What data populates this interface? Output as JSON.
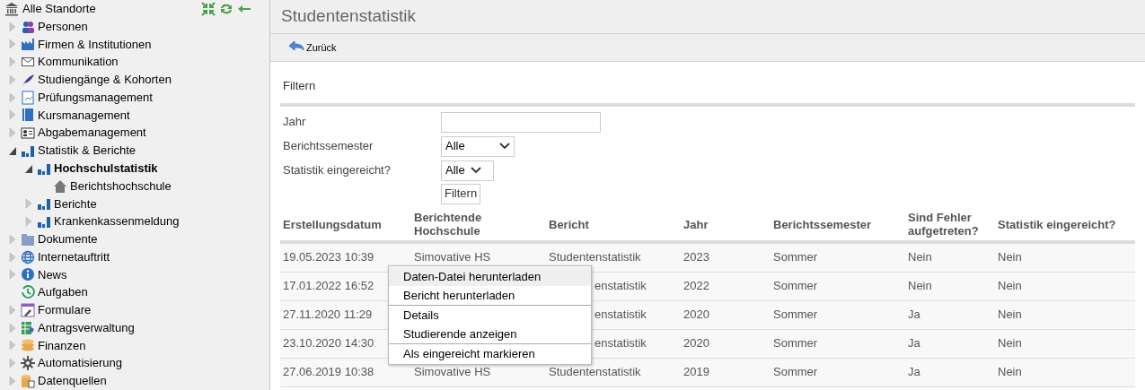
{
  "sidebar": {
    "root": "Alle Standorte",
    "items": [
      {
        "label": "Personen",
        "expanded": false,
        "selected": false
      },
      {
        "label": "Firmen & Institutionen",
        "expanded": false,
        "selected": false
      },
      {
        "label": "Kommunikation",
        "expanded": false,
        "selected": false
      },
      {
        "label": "Studiengänge & Kohorten",
        "expanded": false,
        "selected": false
      },
      {
        "label": "Prüfungsmanagement",
        "expanded": false,
        "selected": false
      },
      {
        "label": "Kursmanagement",
        "expanded": false,
        "selected": false
      },
      {
        "label": "Abgabemanagement",
        "expanded": false,
        "selected": false
      },
      {
        "label": "Statistik & Berichte",
        "expanded": true,
        "selected": false,
        "children": [
          {
            "label": "Hochschulstatistik",
            "expanded": true,
            "selected": true,
            "children": [
              {
                "label": "Berichtshochschule",
                "selected": false
              }
            ]
          },
          {
            "label": "Berichte",
            "expanded": false,
            "selected": false
          },
          {
            "label": "Krankenkassenmeldung",
            "expanded": false,
            "selected": false
          }
        ]
      },
      {
        "label": "Dokumente",
        "expanded": false,
        "selected": false
      },
      {
        "label": "Internetauftritt",
        "expanded": false,
        "selected": false
      },
      {
        "label": "News",
        "expanded": false,
        "selected": false
      },
      {
        "label": "Aufgaben",
        "selected": false
      },
      {
        "label": "Formulare",
        "expanded": false,
        "selected": false
      },
      {
        "label": "Antragsverwaltung",
        "expanded": false,
        "selected": false
      },
      {
        "label": "Finanzen",
        "expanded": false,
        "selected": false
      },
      {
        "label": "Automatisierung",
        "expanded": false,
        "selected": false
      },
      {
        "label": "Datenquellen",
        "expanded": false,
        "selected": false
      }
    ]
  },
  "page": {
    "title": "Studentenstatistik",
    "back_button": "Zurück"
  },
  "filter": {
    "heading": "Filtern",
    "fields": [
      {
        "kind": "text",
        "label": "Jahr"
      },
      {
        "kind": "select",
        "label": "Berichtssemester",
        "value": "Alle"
      },
      {
        "kind": "select",
        "label": "Statistik eingereicht?",
        "value": "Alle"
      }
    ],
    "button": "Filtern"
  },
  "table": {
    "columns": [
      "Erstellungsdatum",
      "Berichtende Hochschule",
      "Bericht",
      "Jahr",
      "Berichtssemester",
      "Sind Fehler aufgetreten?",
      "Statistik eingereicht?"
    ],
    "rows": [
      {
        "under_menu": false,
        "cells": [
          "19.05.2023 10:39",
          "Simovative HS",
          "Studentenstatistik",
          "2023",
          "Sommer",
          "Nein",
          "Nein"
        ]
      },
      {
        "under_menu": true,
        "cells": [
          "17.01.2022 16:52",
          "",
          "enstatistik",
          "2022",
          "Sommer",
          "Nein",
          "Nein"
        ]
      },
      {
        "under_menu": true,
        "cells": [
          "27.11.2020 11:29",
          "",
          "enstatistik",
          "2020",
          "Sommer",
          "Ja",
          "Nein"
        ]
      },
      {
        "under_menu": true,
        "cells": [
          "23.10.2020 14:30",
          "",
          "enstatistik",
          "2020",
          "Sommer",
          "Ja",
          "Nein"
        ]
      },
      {
        "under_menu": false,
        "cells": [
          "27.06.2019 10:38",
          "Simovative HS",
          "Studentenstatistik",
          "2019",
          "Sommer",
          "Ja",
          "Nein"
        ]
      }
    ]
  },
  "context_menu": {
    "groups": [
      [
        {
          "label": "Daten-Datei herunterladen",
          "selected": true
        },
        {
          "label": "Bericht herunterladen",
          "selected": false
        }
      ],
      [
        {
          "label": "Details",
          "selected": false
        },
        {
          "label": "Studierende anzeigen",
          "selected": false
        }
      ],
      [
        {
          "label": "Als eingereicht markieren",
          "selected": false
        }
      ]
    ]
  }
}
